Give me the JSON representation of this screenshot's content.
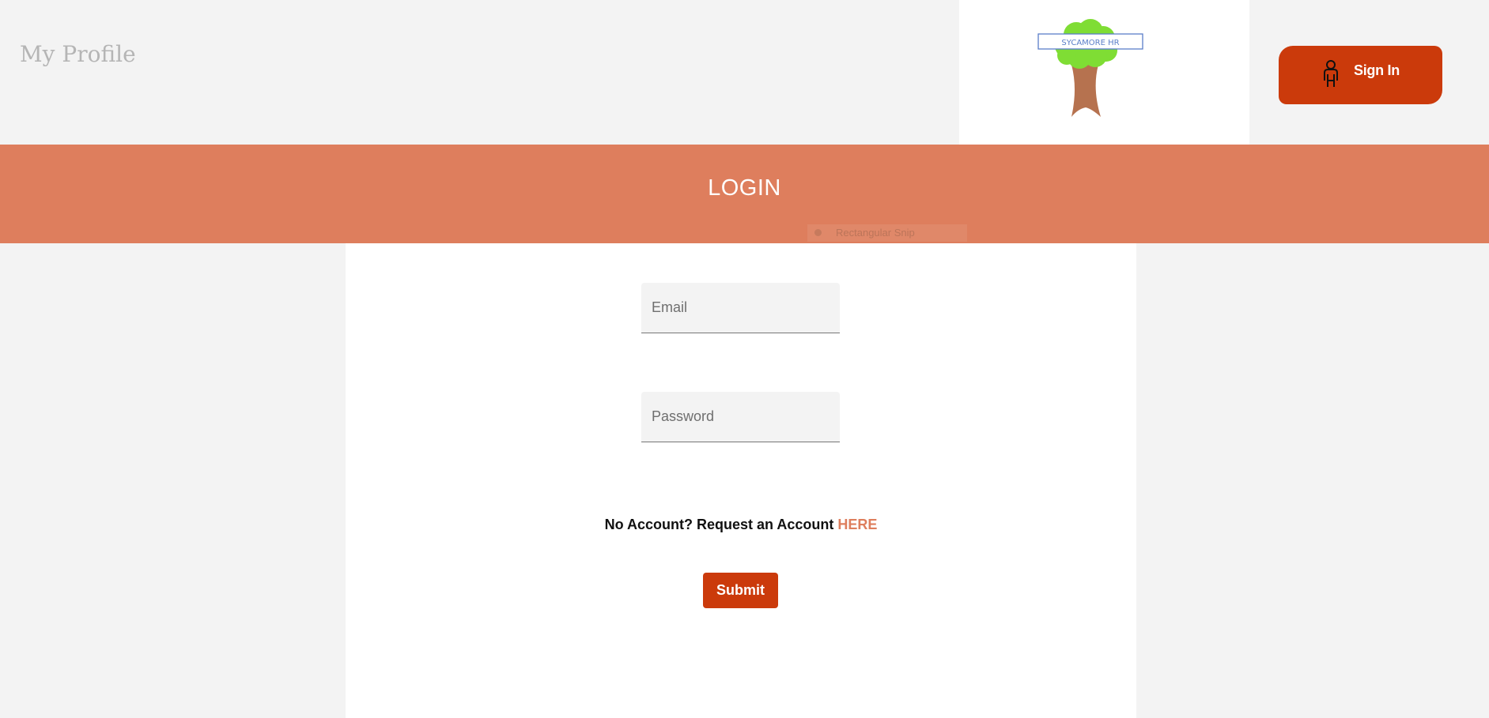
{
  "header": {
    "profile_link": "My Profile",
    "logo_text": "SYCAMORE HR",
    "signin_label": "Sign In"
  },
  "banner": {
    "title": "LOGIN"
  },
  "overlay": {
    "snip_text": "Rectangular Snip"
  },
  "form": {
    "email_placeholder": "Email",
    "password_placeholder": "Password",
    "account_prompt": "No Account? Request an Account",
    "account_link": "HERE",
    "submit_label": "Submit"
  },
  "colors": {
    "accent": "#cb3a0b",
    "banner": "#de7e5d",
    "background": "#f3f3f3"
  }
}
